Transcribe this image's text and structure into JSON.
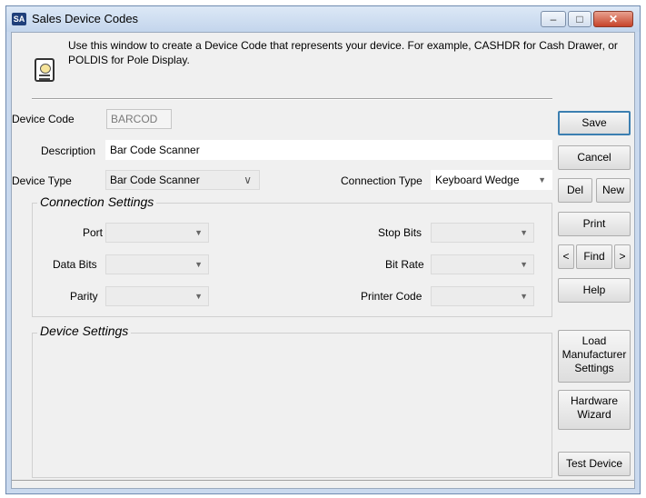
{
  "window": {
    "app_icon": "SA",
    "title": "Sales Device Codes",
    "minimize_glyph": "–",
    "maximize_glyph": "□",
    "close_glyph": "✕"
  },
  "info": {
    "icon": "document-info-icon",
    "text": "Use this window to create a Device Code that represents your device. For example, CASHDR for Cash Drawer, or POLDIS for Pole Display."
  },
  "form": {
    "device_code": {
      "label": "Device Code",
      "value": "BARCOD"
    },
    "description": {
      "label": "Description",
      "value": "Bar Code Scanner"
    },
    "device_type": {
      "label": "Device Type",
      "value": "Bar Code Scanner"
    },
    "connection_type": {
      "label": "Connection Type",
      "value": "Keyboard Wedge"
    }
  },
  "connection_settings": {
    "title": "Connection Settings",
    "port": {
      "label": "Port",
      "value": ""
    },
    "data_bits": {
      "label": "Data Bits",
      "value": ""
    },
    "parity": {
      "label": "Parity",
      "value": ""
    },
    "stop_bits": {
      "label": "Stop Bits",
      "value": ""
    },
    "bit_rate": {
      "label": "Bit Rate",
      "value": ""
    },
    "printer_code": {
      "label": "Printer Code",
      "value": ""
    }
  },
  "device_settings": {
    "title": "Device Settings"
  },
  "buttons": {
    "save": "Save",
    "cancel": "Cancel",
    "del": "Del",
    "new": "New",
    "print": "Print",
    "prev": "<",
    "find": "Find",
    "next": ">",
    "help": "Help",
    "load_line1": "Load",
    "load_line2": "Manufacturer",
    "load_line3": "Settings",
    "wizard_line1": "Hardware",
    "wizard_line2": "Wizard",
    "test_device": "Test Device"
  },
  "glyphs": {
    "dropdown_arrow": "▼",
    "chevron": "∨"
  }
}
